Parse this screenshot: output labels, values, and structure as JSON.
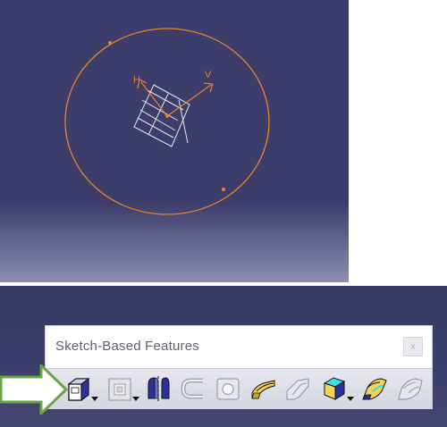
{
  "toolbar": {
    "title": "Sketch-Based Features",
    "close_label": "x",
    "tools": [
      {
        "icon": "pad-icon",
        "has_dropdown": true,
        "active": true
      },
      {
        "icon": "pocket-icon",
        "has_dropdown": true,
        "active": false
      },
      {
        "icon": "shaft-icon",
        "has_dropdown": false,
        "active": true
      },
      {
        "icon": "groove-icon",
        "has_dropdown": false,
        "active": false
      },
      {
        "icon": "hole-icon",
        "has_dropdown": false,
        "active": false
      },
      {
        "icon": "rib-icon",
        "has_dropdown": false,
        "active": true
      },
      {
        "icon": "slot-icon",
        "has_dropdown": false,
        "active": false
      },
      {
        "icon": "solid-combine-icon",
        "has_dropdown": true,
        "active": true
      },
      {
        "icon": "multi-section-solid-icon",
        "has_dropdown": false,
        "active": true
      },
      {
        "icon": "removed-multi-section-solid-icon",
        "has_dropdown": false,
        "active": false
      }
    ]
  },
  "sketch": {
    "axis_h_label": "H",
    "axis_v_label": "V"
  },
  "colors": {
    "viewport_bg": "#3c3d6a",
    "sketch_curve": "#e8832a",
    "callout_arrow": "#6aa543",
    "toolbar_title": "#5d6170"
  }
}
